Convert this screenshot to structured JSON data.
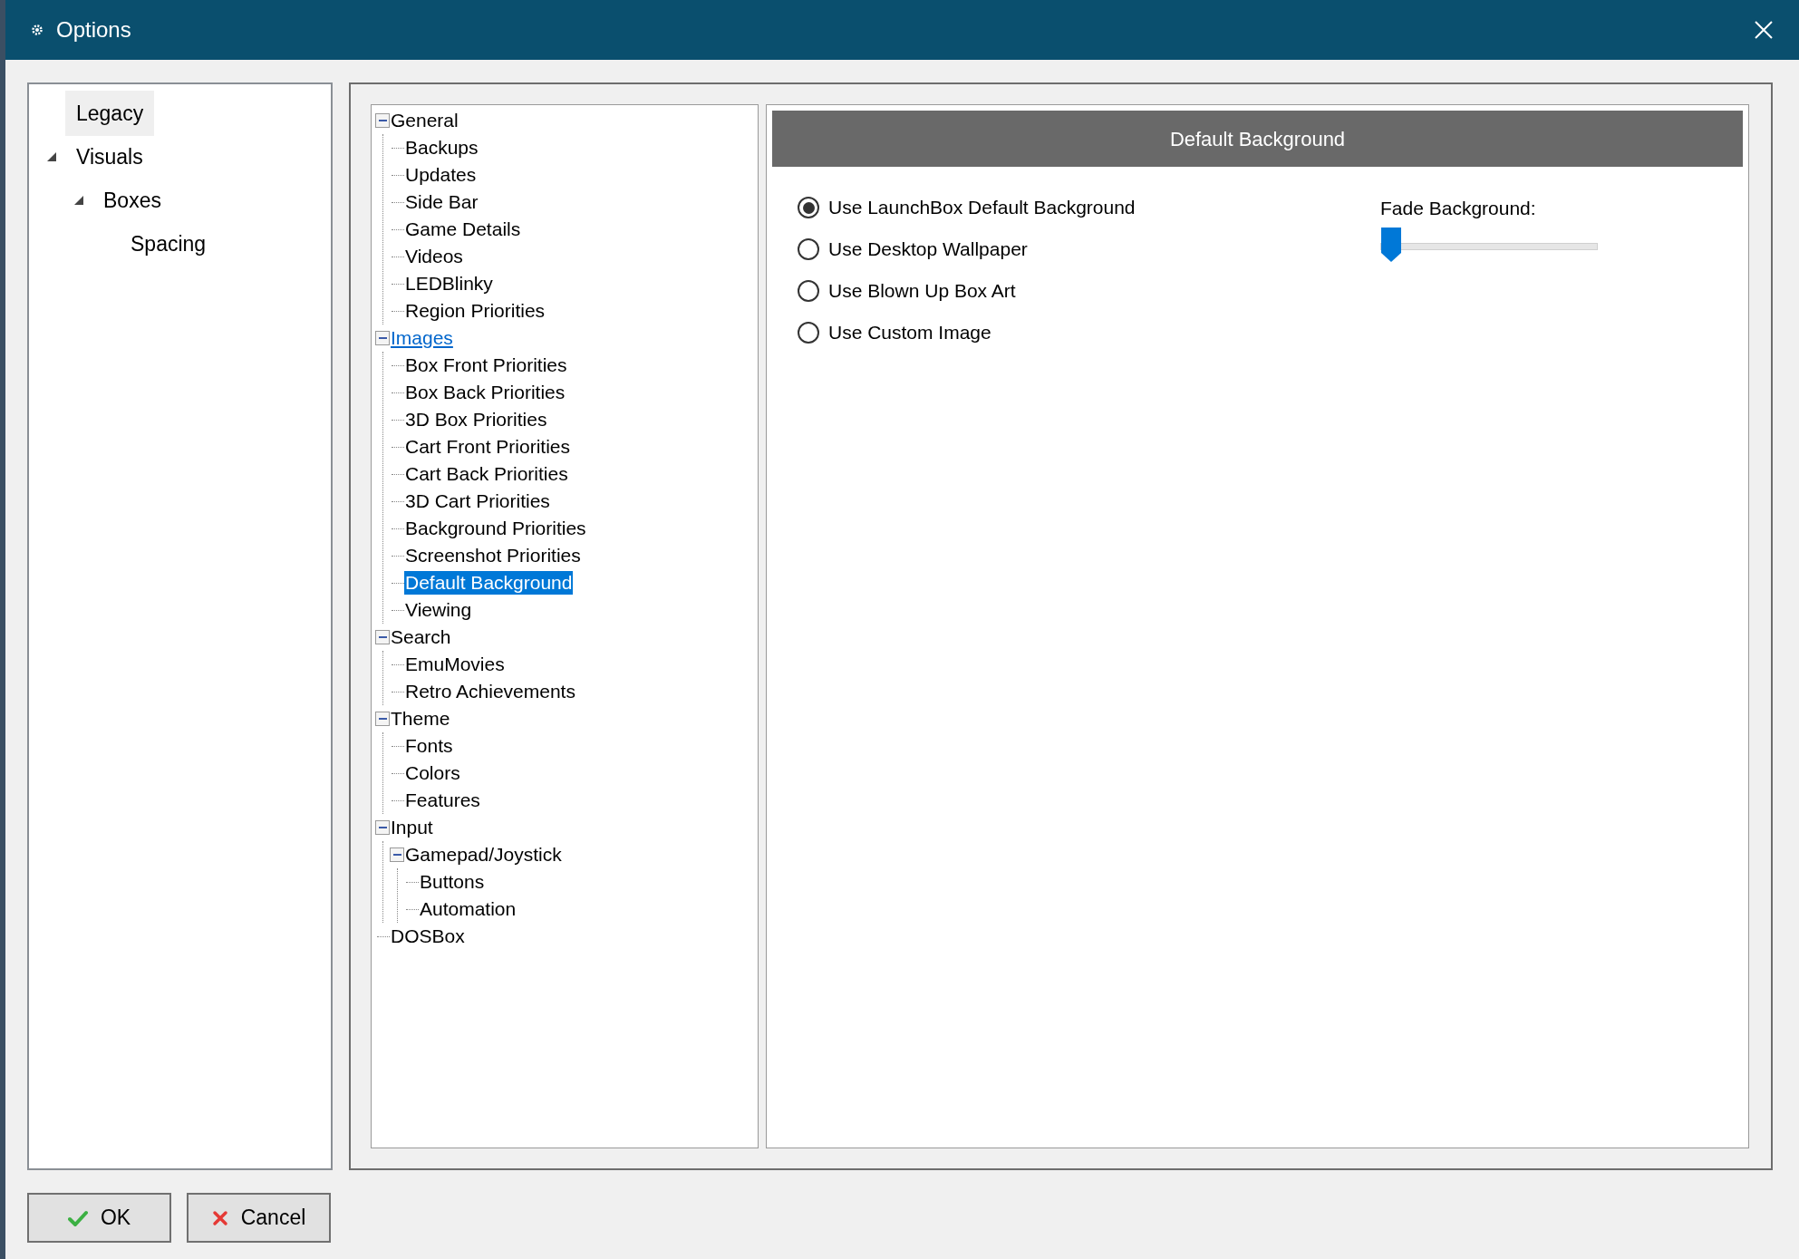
{
  "window": {
    "title": "Options"
  },
  "nav": [
    {
      "label": "Legacy",
      "selected": true
    },
    {
      "label": "Visuals",
      "selected": false,
      "expanded": true,
      "children": [
        {
          "label": "Boxes",
          "selected": false,
          "expanded": true,
          "children": [
            {
              "label": "Spacing",
              "selected": false
            }
          ]
        }
      ]
    }
  ],
  "tree": [
    {
      "label": "General",
      "expanded": true,
      "hovered": false,
      "selected": false,
      "children": [
        {
          "label": "Backups",
          "selected": false
        },
        {
          "label": "Updates",
          "selected": false
        },
        {
          "label": "Side Bar",
          "selected": false
        },
        {
          "label": "Game Details",
          "selected": false
        },
        {
          "label": "Videos",
          "selected": false
        },
        {
          "label": "LEDBlinky",
          "selected": false
        },
        {
          "label": "Region Priorities",
          "selected": false
        }
      ]
    },
    {
      "label": "Images",
      "expanded": true,
      "hovered": true,
      "selected": false,
      "children": [
        {
          "label": "Box Front Priorities",
          "selected": false
        },
        {
          "label": "Box Back Priorities",
          "selected": false
        },
        {
          "label": "3D Box Priorities",
          "selected": false
        },
        {
          "label": "Cart Front Priorities",
          "selected": false
        },
        {
          "label": "Cart Back Priorities",
          "selected": false
        },
        {
          "label": "3D Cart Priorities",
          "selected": false
        },
        {
          "label": "Background Priorities",
          "selected": false
        },
        {
          "label": "Screenshot Priorities",
          "selected": false
        },
        {
          "label": "Default Background",
          "selected": true
        },
        {
          "label": "Viewing",
          "selected": false
        }
      ]
    },
    {
      "label": "Search",
      "expanded": true,
      "hovered": false,
      "selected": false,
      "children": [
        {
          "label": "EmuMovies",
          "selected": false
        },
        {
          "label": "Retro Achievements",
          "selected": false
        }
      ]
    },
    {
      "label": "Theme",
      "expanded": true,
      "hovered": false,
      "selected": false,
      "children": [
        {
          "label": "Fonts",
          "selected": false
        },
        {
          "label": "Colors",
          "selected": false
        },
        {
          "label": "Features",
          "selected": false
        }
      ]
    },
    {
      "label": "Input",
      "expanded": true,
      "hovered": false,
      "selected": false,
      "children": [
        {
          "label": "Gamepad/Joystick",
          "expanded": true,
          "selected": false,
          "children": [
            {
              "label": "Buttons",
              "selected": false
            },
            {
              "label": "Automation",
              "selected": false
            }
          ]
        }
      ]
    },
    {
      "label": "DOSBox",
      "selected": false
    }
  ],
  "panel": {
    "title": "Default Background",
    "options": [
      {
        "label": "Use LaunchBox Default Background",
        "selected": true
      },
      {
        "label": "Use Desktop Wallpaper",
        "selected": false
      },
      {
        "label": "Use Blown Up Box Art",
        "selected": false
      },
      {
        "label": "Use Custom Image",
        "selected": false
      }
    ],
    "fade": {
      "label": "Fade Background:",
      "level": 0
    }
  },
  "buttons": [
    {
      "kind": "ok",
      "label": "OK"
    },
    {
      "kind": "cancel",
      "label": "Cancel"
    }
  ]
}
